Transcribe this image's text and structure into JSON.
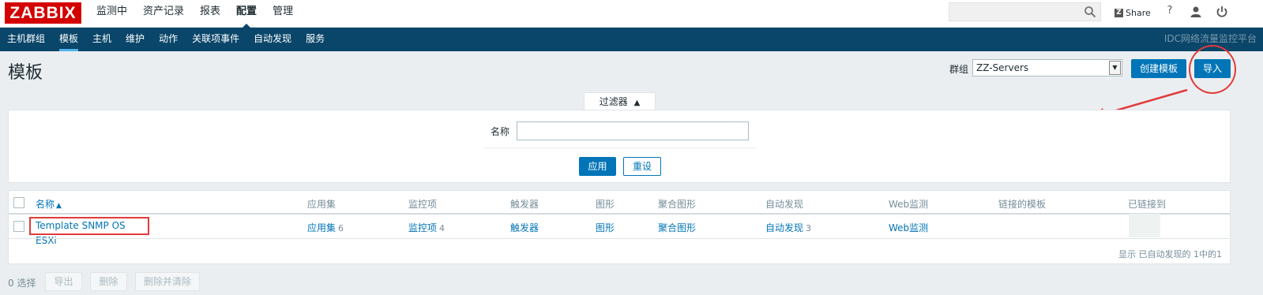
{
  "header": {
    "logo": "ZABBIX",
    "menu": [
      {
        "label": "监测中",
        "selected": false
      },
      {
        "label": "资产记录",
        "selected": false
      },
      {
        "label": "报表",
        "selected": false
      },
      {
        "label": "配置",
        "selected": true
      },
      {
        "label": "管理",
        "selected": false
      }
    ],
    "search_value": "",
    "share_label": "Share",
    "share_badge": "Z",
    "help_glyph": "?",
    "icons": [
      "search-icon",
      "share-icon",
      "help-icon",
      "user-icon",
      "power-icon"
    ]
  },
  "subnav": {
    "items": [
      {
        "label": "主机群组",
        "selected": false
      },
      {
        "label": "模板",
        "selected": true
      },
      {
        "label": "主机",
        "selected": false
      },
      {
        "label": "维护",
        "selected": false
      },
      {
        "label": "动作",
        "selected": false
      },
      {
        "label": "关联项事件",
        "selected": false
      },
      {
        "label": "自动发现",
        "selected": false
      },
      {
        "label": "服务",
        "selected": false
      }
    ],
    "right_text": "IDC网络流量监控平台"
  },
  "page": {
    "title": "模板",
    "group_label": "群组",
    "group_value": "ZZ-Servers",
    "create_button": "创建模板",
    "import_button": "导入"
  },
  "filter": {
    "tab_label": "过滤器",
    "tab_arrow": "▲",
    "name_label": "名称",
    "name_value": "",
    "apply_button": "应用",
    "reset_button": "重设"
  },
  "table": {
    "columns": [
      {
        "label": "名称",
        "sort": "▲"
      },
      {
        "label": "应用集"
      },
      {
        "label": "监控项"
      },
      {
        "label": "触发器"
      },
      {
        "label": "图形"
      },
      {
        "label": "聚合图形"
      },
      {
        "label": "自动发现"
      },
      {
        "label": "Web监测"
      },
      {
        "label": "链接的模板"
      },
      {
        "label": "已链接到"
      }
    ],
    "rows": [
      {
        "name": "Template SNMP OS ESXi",
        "applications": {
          "label": "应用集",
          "count": "6"
        },
        "items": {
          "label": "监控项",
          "count": "4"
        },
        "triggers": {
          "label": "触发器",
          "count": ""
        },
        "graphs": {
          "label": "图形",
          "count": ""
        },
        "screens": {
          "label": "聚合图形",
          "count": ""
        },
        "discovery": {
          "label": "自动发现",
          "count": "3"
        },
        "web": {
          "label": "Web监测",
          "count": ""
        },
        "linked_templates": "",
        "linked_to": ""
      }
    ],
    "summary": "显示 已自动发现的 1中的1"
  },
  "footer": {
    "selected_count": "0 选择",
    "buttons": [
      "导出",
      "删除",
      "删除并清除"
    ]
  },
  "colors": {
    "brand": "#d40000",
    "nav_bg": "#0a466a",
    "accent": "#0275b8",
    "annotation": "#e23a3a"
  }
}
